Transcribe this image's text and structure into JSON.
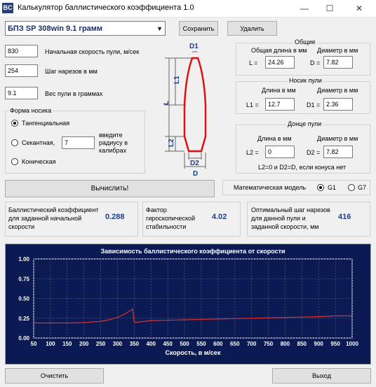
{
  "window": {
    "app_icon": "BC",
    "title": "Калькулятор баллистического коэффициента 1.0",
    "controls": {
      "minimize": "—",
      "maximize": "☐",
      "close": "✕"
    }
  },
  "toolbar": {
    "bullet_select": "БПЗ SP 308win 9.1 грамм",
    "save_label": "Сохранить",
    "delete_label": "Удалить"
  },
  "inputs": {
    "velocity": {
      "value": "830",
      "label": "Начальная скорость пули, м/сек"
    },
    "twist": {
      "value": "254",
      "label": "Шаг нарезов в мм"
    },
    "weight": {
      "value": "9.1",
      "label": "Вес пули в граммах"
    }
  },
  "nose_shape": {
    "title": "Форма носика",
    "tangent": "Тангенциальная",
    "secant": "Секантная,",
    "secant_value": "7",
    "secant_hint": "введите радиусу в калибрах",
    "conical": "Коническая",
    "selected": "tangent"
  },
  "diagram": {
    "d1": "D1",
    "l1": "L1",
    "l": "L",
    "l2": "L2",
    "d2": "D2",
    "d": "D"
  },
  "general": {
    "title": "Общие",
    "length_label": "Общая длина в мм",
    "diam_label": "Диаметр в мм",
    "l_prefix": "L =",
    "l_value": "24.26",
    "d_prefix": "D =",
    "d_value": "7.82"
  },
  "nose": {
    "title": "Носик пули",
    "length_label": "Длина в мм",
    "diam_label": "Диаметр в мм",
    "l_prefix": "L1 =",
    "l_value": "12.7",
    "d_prefix": "D1 =",
    "d_value": "2.36"
  },
  "base": {
    "title": "Донце пули",
    "length_label": "Длина в мм",
    "diam_label": "Диаметр в мм",
    "l_prefix": "L2 =",
    "l_value": "0",
    "d_prefix": "D2 =",
    "d_value": "7.82",
    "note": "L2=0 и D2=D, если конуса нет"
  },
  "calc_label": "Вычислить!",
  "model": {
    "label": "Математическая модель",
    "g1": "G1",
    "g7": "G7",
    "selected": "G1"
  },
  "results": {
    "bc_label": "Баллистический коэффициент для заданной начальной скорости",
    "bc_value": "0.288",
    "gyro_label": "Фактор гироскопической стабильности",
    "gyro_value": "4.02",
    "twist_label": "Оптимальный шаг нарезов для данной пули и заданной скорости, мм",
    "twist_value": "416"
  },
  "chart_data": {
    "type": "line",
    "title": "Зависимость баллистического коэффициента от скорости",
    "xlabel": "Скорость, в м/сек",
    "ylabel": "",
    "xlim": [
      50,
      1000
    ],
    "ylim": [
      0,
      1
    ],
    "x_ticks": [
      50,
      100,
      150,
      200,
      250,
      300,
      350,
      400,
      450,
      500,
      550,
      600,
      650,
      700,
      750,
      800,
      850,
      900,
      950,
      1000
    ],
    "y_ticks": [
      "1.00",
      "0.75",
      "0.50",
      "0.25",
      "0.00"
    ],
    "grid": true,
    "series": [
      {
        "values_x": [
          50,
          100,
          150,
          200,
          250,
          275,
          300,
          320,
          340,
          345,
          350,
          360,
          380,
          400,
          450,
          500,
          550,
          600,
          650,
          700,
          750,
          800,
          850,
          900,
          950,
          1000
        ],
        "values_y": [
          0.19,
          0.19,
          0.19,
          0.195,
          0.21,
          0.23,
          0.26,
          0.3,
          0.35,
          0.37,
          0.2,
          0.2,
          0.21,
          0.22,
          0.225,
          0.23,
          0.235,
          0.24,
          0.245,
          0.25,
          0.255,
          0.26,
          0.265,
          0.27,
          0.28,
          0.28
        ],
        "color": "#e03030"
      }
    ],
    "background": "#0b1a52",
    "text_color": "#ffffff"
  },
  "footer": {
    "clear_label": "Очистить",
    "exit_label": "Выход"
  }
}
